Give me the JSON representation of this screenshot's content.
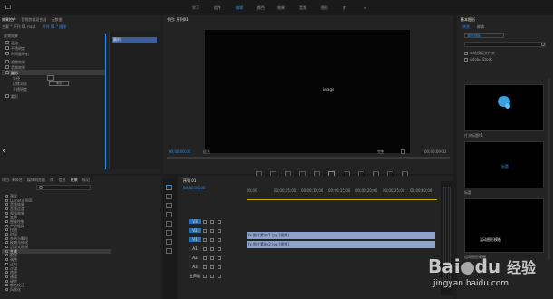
{
  "topnav": {
    "items": [
      "学习",
      "组件",
      "编辑",
      "颜色",
      "效果",
      "音频",
      "图形",
      "库"
    ],
    "active_index": 2
  },
  "effect_controls": {
    "tab1": "效果控件",
    "tab2": "音频剪辑混合器",
    "tab3": "元数据",
    "source": "主要 * 序列 01 mp4",
    "sequence": "序列 01 * 圆形",
    "fx_header": "视频效果",
    "items": [
      "运动",
      "不透明度",
      "时间重映射",
      "视频效果",
      "音频效果",
      "圆形"
    ],
    "sub_items": [
      "半径",
      "边缘羽化",
      "不透明度"
    ],
    "mini_button": "重置",
    "clip_label": "圆形"
  },
  "program": {
    "title": "节目: 序列01",
    "timecode_left": "00;00;00;00",
    "fit": "适合",
    "quality": "完整",
    "timecode_right": "00;00;09;02",
    "center_text": "image"
  },
  "project": {
    "tabs": [
      "项目: 未命名",
      "媒体浏览器",
      "库",
      "信息",
      "效果",
      "标记"
    ],
    "active_tab": "效果",
    "items": [
      "预设",
      "Lumetri 预设",
      "音频效果",
      "音频过渡",
      "视频效果",
      "变换",
      "图像控制",
      "实用程序",
      "扭曲",
      "时间",
      "杂色与颗粒",
      "模糊与锐化",
      "沉浸式视频",
      "生成",
      "视频",
      "调整",
      "过时",
      "过渡",
      "透视",
      "通道",
      "键控",
      "颜色校正",
      "风格化"
    ],
    "selected_index": 13
  },
  "timeline": {
    "title": "序列 01",
    "timecode": "00;00;00;00",
    "ruler": [
      "00;00",
      "00;00;05;00",
      "00;00;10;00",
      "00;00;15;00",
      "00;00;20;00",
      "00;00;25;00",
      "00;00;30;00"
    ],
    "tracks": [
      "V3",
      "V2",
      "V1",
      "A1",
      "A2",
      "A3",
      "主声道"
    ],
    "clip1": "fx 图片素材/1.jpg [视频]",
    "clip2": "fx 图片素材/2.jpg [视频]"
  },
  "essential_graphics": {
    "title": "基本图形",
    "tab_browse": "浏览",
    "tab_edit": "编辑",
    "dropdown": "我的模板",
    "search_placeholder": "",
    "checkbox1": "本地模板文件夹",
    "checkbox2": "Adobe Stock",
    "thumb1_label": "片头标题01",
    "thumb2_label": "标题",
    "thumb3_label": "运动图形模板",
    "thumb2_text": "标题",
    "thumb3_text": "运动图形模板"
  },
  "watermark": {
    "brand": "Bai",
    "brand2": "du",
    "cn": "经验",
    "url": "jingyan.baidu.com"
  }
}
